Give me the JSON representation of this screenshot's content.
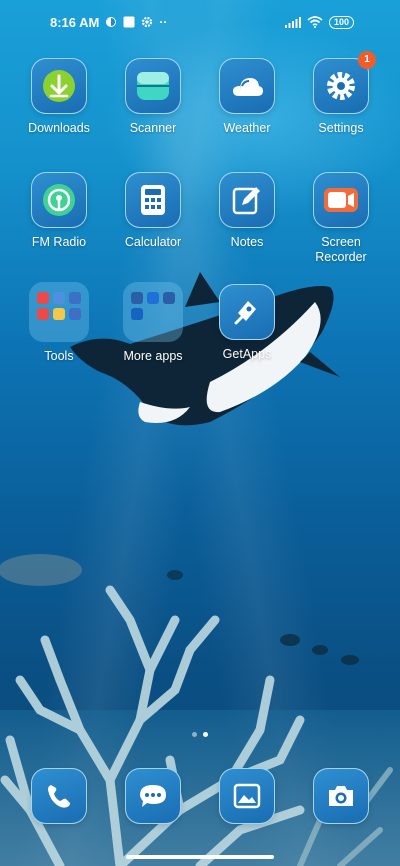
{
  "status_bar": {
    "time": "8:16 AM",
    "battery": "100"
  },
  "apps": [
    {
      "label": "Downloads",
      "icon": "downloads-icon"
    },
    {
      "label": "Scanner",
      "icon": "scanner-icon"
    },
    {
      "label": "Weather",
      "icon": "weather-icon"
    },
    {
      "label": "Settings",
      "icon": "settings-icon",
      "badge": "1"
    },
    {
      "label": "FM Radio",
      "icon": "fm-radio-icon"
    },
    {
      "label": "Calculator",
      "icon": "calculator-icon"
    },
    {
      "label": "Notes",
      "icon": "notes-icon"
    },
    {
      "label": "Screen Recorder",
      "icon": "screen-recorder-icon"
    },
    {
      "label": "Tools",
      "icon": "folder-icon"
    },
    {
      "label": "More apps",
      "icon": "folder-icon"
    },
    {
      "label": "GetApps",
      "icon": "getapps-icon"
    }
  ],
  "dock": [
    {
      "icon": "phone-icon"
    },
    {
      "icon": "messages-icon"
    },
    {
      "icon": "gallery-icon"
    },
    {
      "icon": "camera-icon"
    }
  ],
  "colors": {
    "icon_bg": "#1a6db2",
    "icon_border": "#b4e6ff",
    "badge": "#f25c2a"
  }
}
